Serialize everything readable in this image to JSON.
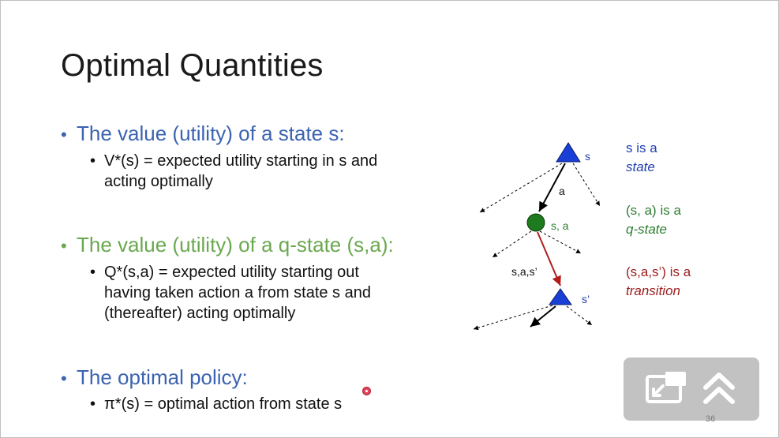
{
  "slide": {
    "title": "Optimal Quantities",
    "bullets": [
      {
        "text": "The value (utility) of a state s:",
        "color": "#3b63b0",
        "sub_lines": [
          "V*(s) = expected utility starting in s and",
          "acting optimally"
        ]
      },
      {
        "text": "The value (utility) of a q-state (s,a):",
        "color": "#6aa84f",
        "sub_lines": [
          "Q*(s,a) = expected utility starting out",
          "having taken action a from state s and",
          "(thereafter) acting optimally"
        ]
      },
      {
        "text": "The optimal policy:",
        "color": "#3b63b0",
        "sub_lines": [
          "π*(s) = optimal action from state s"
        ]
      }
    ],
    "bullet_glyph": "•",
    "page_number": "36"
  },
  "diagram": {
    "labels": {
      "s": "s",
      "a": "a",
      "sa": "s, a",
      "sas": "s,a,s’",
      "sprime": "s’"
    },
    "notes": [
      {
        "line1": "s is a",
        "line2": "state",
        "color": "#1f3fae"
      },
      {
        "line1": "(s, a) is a",
        "line2": "q-state",
        "color": "#2e7d32"
      },
      {
        "line1": "(s,a,s’) is a",
        "line2": "transition",
        "color": "#9b1c1c"
      }
    ],
    "colors": {
      "state": "#1a3fd6",
      "qstate": "#1e7a1e",
      "transition": "#b01c1c"
    }
  },
  "overlay": {
    "buttons": [
      {
        "icon": "picture-in-picture-icon"
      },
      {
        "icon": "double-chevron-up-icon"
      }
    ]
  }
}
